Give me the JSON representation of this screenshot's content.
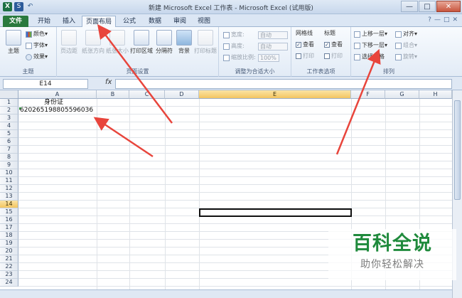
{
  "window": {
    "title": "新建 Microsoft Excel 工作表 - Microsoft Excel (试用版)",
    "quick_access": [
      "X",
      "S",
      "↶"
    ],
    "buttons": [
      "—",
      "□",
      "✕"
    ]
  },
  "tabs": [
    {
      "label": "文件",
      "kind": "file"
    },
    {
      "label": "开始"
    },
    {
      "label": "插入"
    },
    {
      "label": "页面布局",
      "active": true
    },
    {
      "label": "公式"
    },
    {
      "label": "数据"
    },
    {
      "label": "审阅"
    },
    {
      "label": "视图"
    }
  ],
  "tab_icons": [
    "?",
    "—",
    "□",
    "✕"
  ],
  "ribbon": {
    "theme_group": {
      "label": "主题",
      "theme_button": "主题",
      "colors": "颜色▾",
      "fonts": "字体▾",
      "effects": "效果▾"
    },
    "page_setup": {
      "label": "页面设置",
      "margins": "页边距",
      "orientation": "纸张方向",
      "size": "纸张大小",
      "print_area": "打印区域",
      "breaks": "分隔符",
      "background": "背景",
      "print_titles": "打印标题"
    },
    "scale_to_fit": {
      "label": "调整为合适大小",
      "width_label": "宽度:",
      "width_value": "自动",
      "height_label": "高度:",
      "height_value": "自动",
      "scale_label": "缩放比例:",
      "scale_value": "100%"
    },
    "sheet_options": {
      "label": "工作表选项",
      "gridlines": "网格线",
      "headings": "标题",
      "view": "查看",
      "print": "打印",
      "view2": "查看",
      "print2": "打印"
    },
    "arrange": {
      "label": "排列",
      "bring_forward": "上移一层▾",
      "send_backward": "下移一层▾",
      "selection_pane": "选择窗格",
      "align": "对齐▾",
      "group": "组合▾",
      "rotate": "旋转▾"
    }
  },
  "formula_bar": {
    "name_box": "E14",
    "fx": "fx",
    "value": ""
  },
  "sheet": {
    "columns": [
      "A",
      "B",
      "C",
      "D",
      "E",
      "F",
      "G",
      "H"
    ],
    "selected_column": "E",
    "rows": [
      "1",
      "2",
      "3",
      "4",
      "5",
      "6",
      "7",
      "8",
      "9",
      "10",
      "11",
      "12",
      "13",
      "14",
      "15",
      "16",
      "17",
      "18",
      "19",
      "20",
      "21",
      "22",
      "23",
      "24"
    ],
    "selected_row": "14",
    "cells": {
      "A1": "身份证",
      "A2": "620265198805596036"
    }
  },
  "watermark": {
    "title": "百科全说",
    "subtitle": "助你轻松解决"
  }
}
